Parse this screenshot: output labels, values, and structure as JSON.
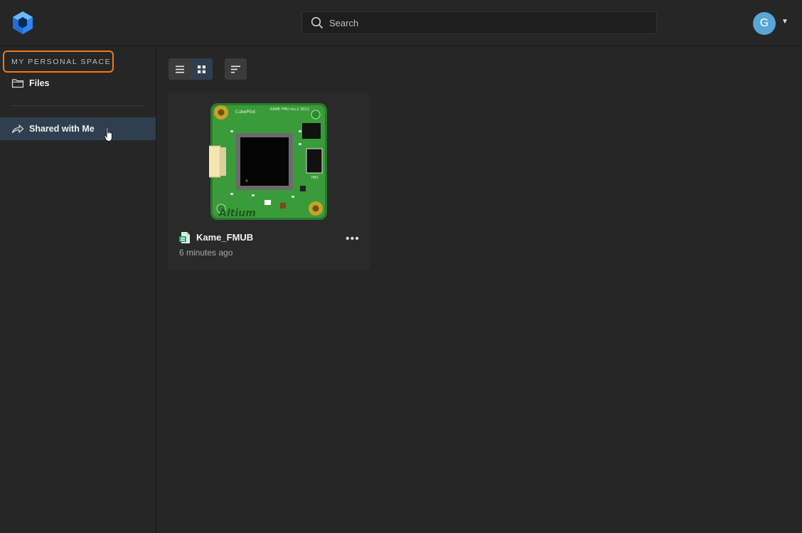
{
  "header": {
    "logo_icon": "altium-365-logo-icon",
    "search_placeholder": "Search",
    "avatar_initial": "G",
    "avatar_color": "#5aa6d6"
  },
  "sidebar": {
    "section_label": "MY PERSONAL SPACE",
    "files_label": "Files",
    "shared_label": "Shared with Me",
    "highlight_color": "#ee7a1a"
  },
  "toolbar": {
    "list_view_icon": "list-view-icon",
    "grid_view_icon": "grid-view-icon",
    "sort_icon": "sort-icon"
  },
  "files": [
    {
      "name": "Kame_FMUB",
      "modified": "6 minutes ago",
      "thumbnail_icon": "pcb-board-thumbnail",
      "board_text": {
        "brand": "Altium",
        "maker": "CubePilot",
        "board_title": "KAME FMU rev.2 2022",
        "imu_label": "IMU"
      }
    }
  ]
}
